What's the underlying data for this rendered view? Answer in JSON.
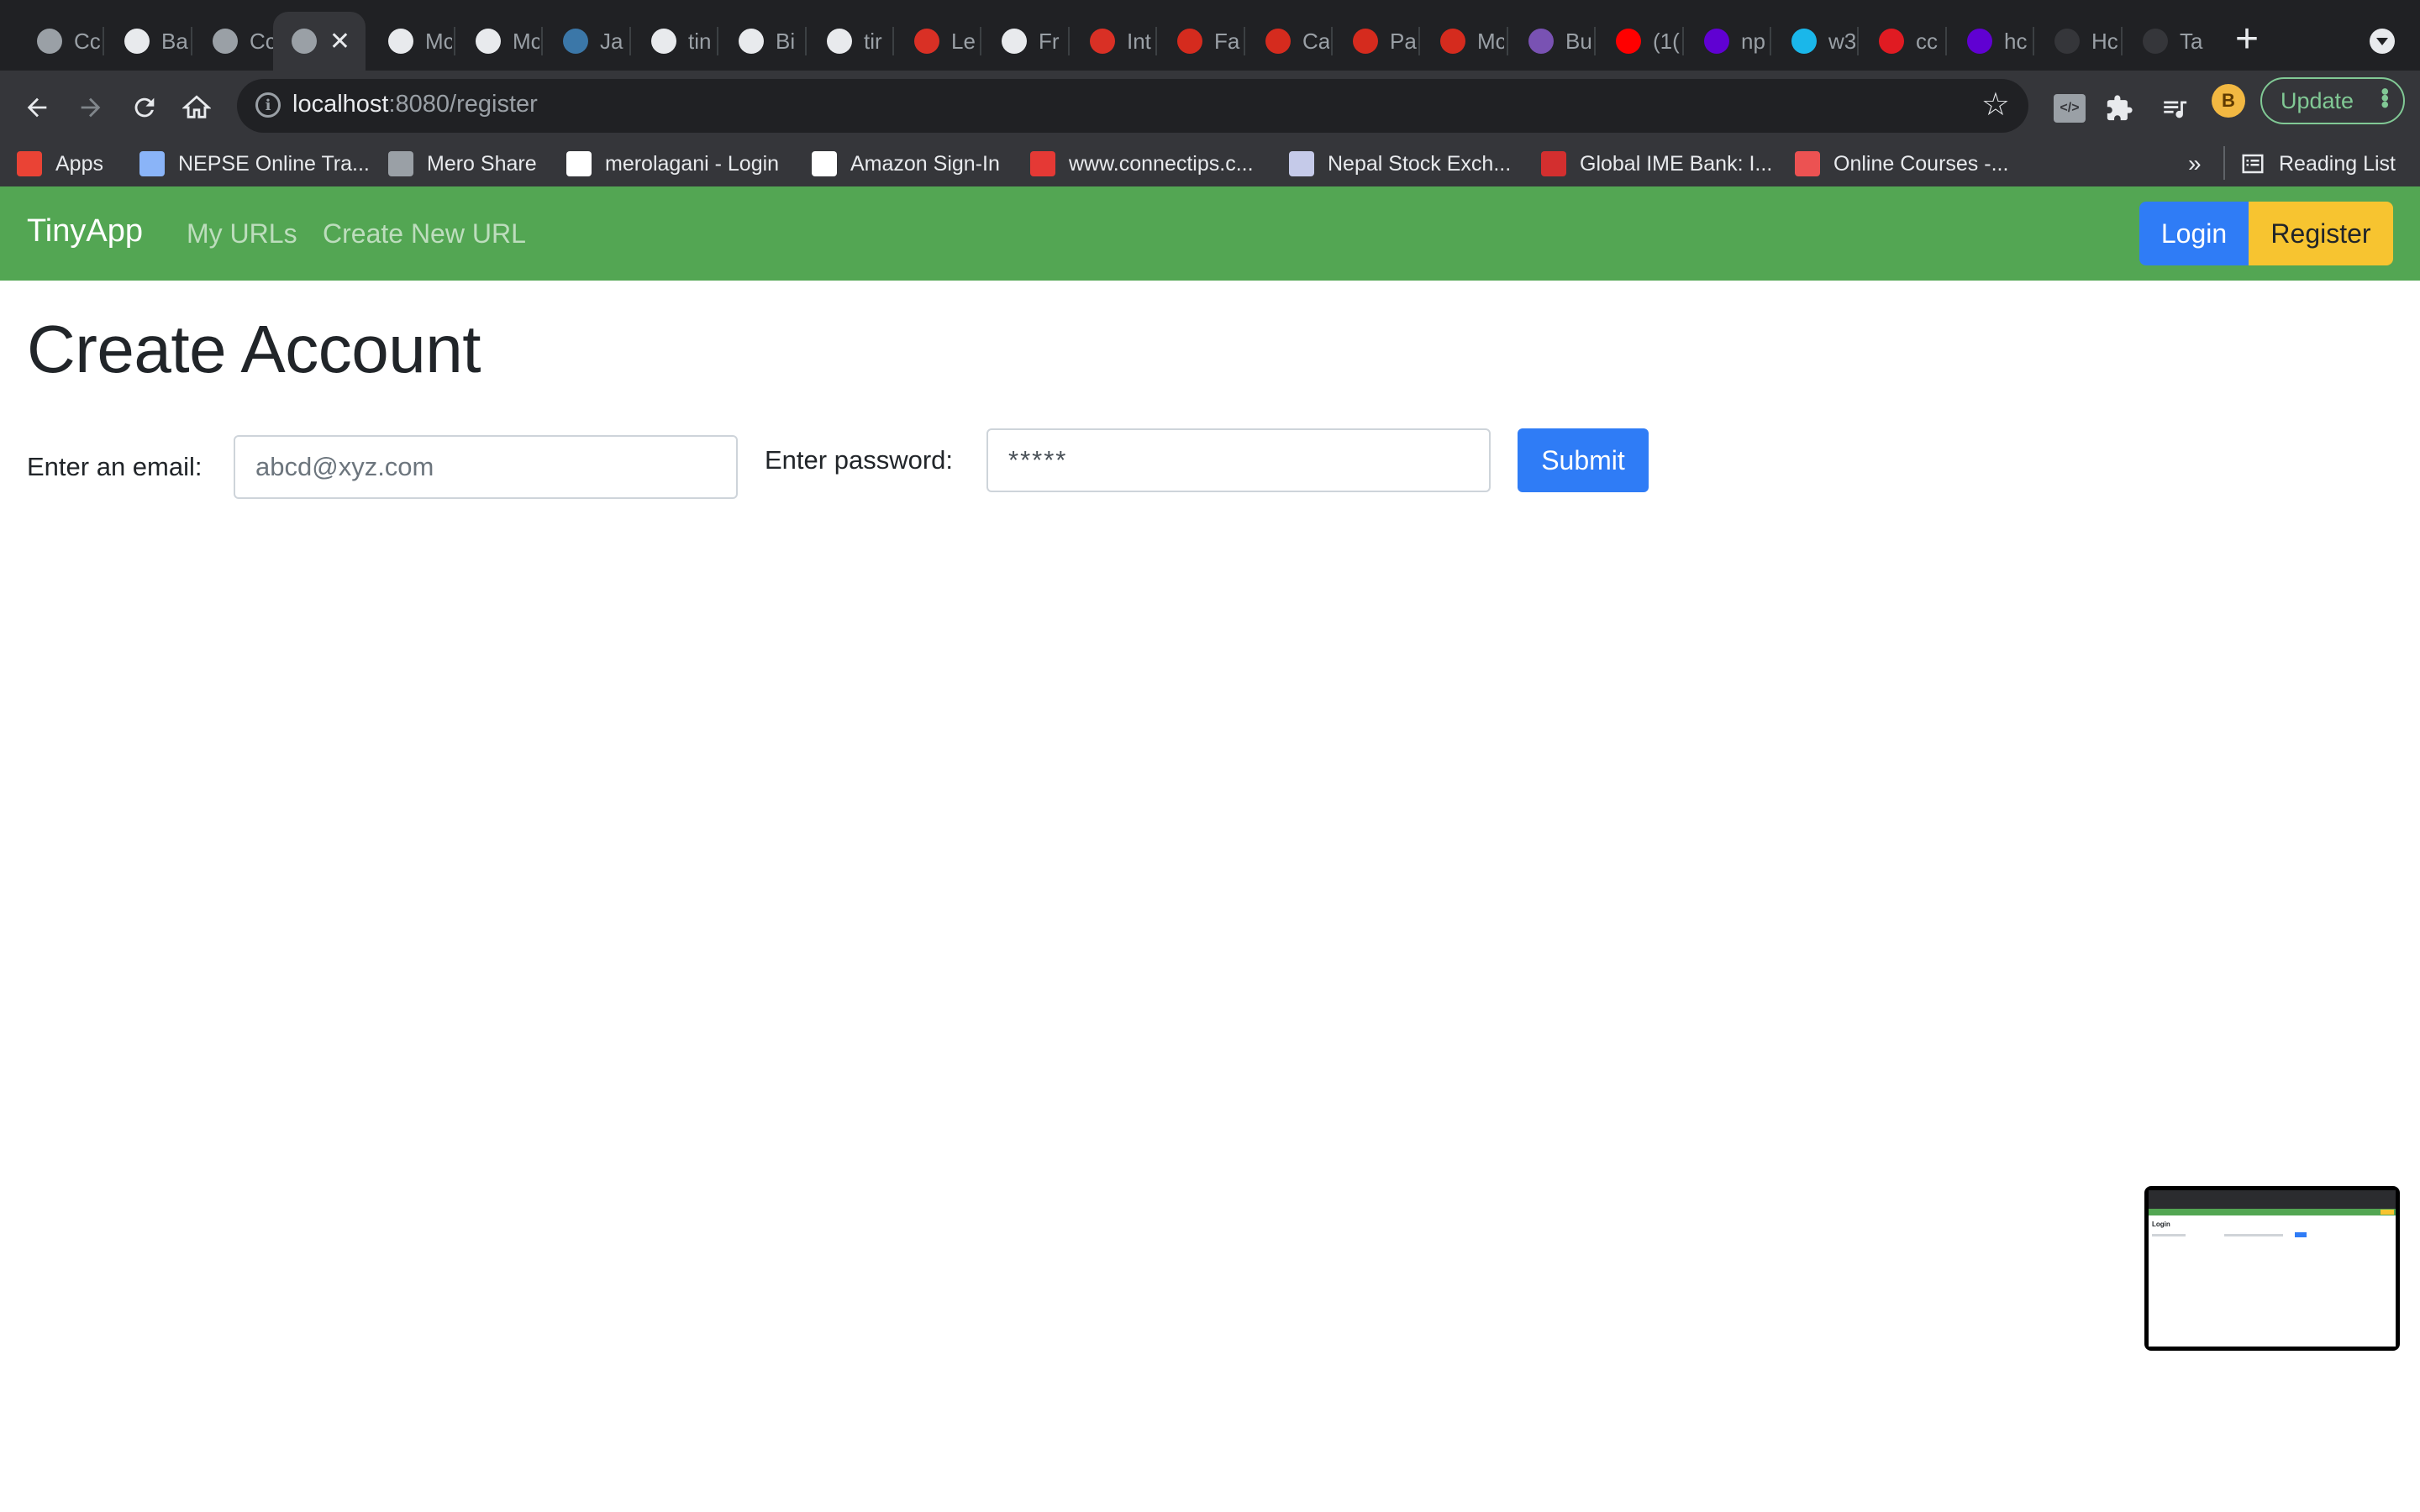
{
  "browser": {
    "tabs": [
      {
        "title": "Cc",
        "icon": "circle-arrow-icon",
        "color": "#202124",
        "bg": "#9aa0a6"
      },
      {
        "title": "Ba",
        "icon": "github-icon",
        "color": "#202124",
        "bg": "#e8eaed"
      },
      {
        "title": "Cc",
        "icon": "circle-arrow-icon",
        "color": "#202124",
        "bg": "#9aa0a6"
      },
      {
        "title": "",
        "icon": "globe-icon",
        "color": "#202124",
        "bg": "#9aa0a6",
        "active": true
      },
      {
        "title": "Mc",
        "icon": "spiral-icon",
        "color": "#202124",
        "bg": "#e8eaed"
      },
      {
        "title": "Mc",
        "icon": "spiral-icon",
        "color": "#202124",
        "bg": "#e8eaed"
      },
      {
        "title": "Ja",
        "icon": "python-icon",
        "color": "#f4c542",
        "bg": "#3b77a8"
      },
      {
        "title": "tin",
        "icon": "github-icon",
        "color": "#202124",
        "bg": "#e8eaed"
      },
      {
        "title": "Bi",
        "icon": "github-icon",
        "color": "#202124",
        "bg": "#e8eaed"
      },
      {
        "title": "tir",
        "icon": "github-icon",
        "color": "#202124",
        "bg": "#e8eaed"
      },
      {
        "title": "Le",
        "icon": "gmail-icon",
        "color": "#ffffff",
        "bg": "#d93025"
      },
      {
        "title": "Fr",
        "icon": "github-icon",
        "color": "#202124",
        "bg": "#e8eaed"
      },
      {
        "title": "Int",
        "icon": "gmail-icon",
        "color": "#ffffff",
        "bg": "#d93025"
      },
      {
        "title": "Fa",
        "icon": "maple-leaf-icon",
        "color": "#ffffff",
        "bg": "#d52b1e"
      },
      {
        "title": "Ca",
        "icon": "maple-leaf-icon",
        "color": "#ffffff",
        "bg": "#d52b1e"
      },
      {
        "title": "Pa",
        "icon": "maple-leaf-icon",
        "color": "#ffffff",
        "bg": "#d52b1e"
      },
      {
        "title": "Mc",
        "icon": "maple-leaf-icon",
        "color": "#ffffff",
        "bg": "#d52b1e"
      },
      {
        "title": "Bu",
        "icon": "bootstrap-icon",
        "color": "#ffffff",
        "bg": "#7952b3"
      },
      {
        "title": "(1(",
        "icon": "youtube-icon",
        "color": "#ffffff",
        "bg": "#ff0000"
      },
      {
        "title": "np",
        "icon": "yahoo-icon",
        "color": "#ffffff",
        "bg": "#6001d2"
      },
      {
        "title": "w3",
        "icon": "vimeo-icon",
        "color": "#ffffff",
        "bg": "#1ab7ea"
      },
      {
        "title": "cc",
        "icon": "red-square-icon",
        "color": "#ffffff",
        "bg": "#e01b22"
      },
      {
        "title": "hc",
        "icon": "yahoo-icon",
        "color": "#ffffff",
        "bg": "#6001d2"
      },
      {
        "title": "Hc",
        "icon": "stackoverflow-icon",
        "color": "#f48024",
        "bg": "#35363a"
      },
      {
        "title": "Ta",
        "icon": "apple-icon",
        "color": "#e8eaed",
        "bg": "#35363a"
      }
    ],
    "new_tab_label": "+",
    "url_host": "localhost",
    "url_path": ":8080/register",
    "update_label": "Update",
    "profile_initial": "B",
    "bookmarks": [
      {
        "label": "Apps",
        "icon": "apps-grid-icon",
        "color": "#ea4335"
      },
      {
        "label": "NEPSE Online Tra...",
        "icon": "nepse-icon",
        "color": "#8ab4f8"
      },
      {
        "label": "Mero Share",
        "icon": "mero-share-icon",
        "color": "#9aa0a6"
      },
      {
        "label": "merolagani - Login",
        "icon": "page-icon",
        "color": "#ffffff"
      },
      {
        "label": "Amazon Sign-In",
        "icon": "amazon-icon",
        "color": "#ffffff"
      },
      {
        "label": "www.connectips.c...",
        "icon": "connectips-icon",
        "color": "#e53935"
      },
      {
        "label": "Nepal Stock Exch...",
        "icon": "nepse-page-icon",
        "color": "#c5cae9"
      },
      {
        "label": "Global IME Bank: I...",
        "icon": "global-ime-icon",
        "color": "#d32f2f"
      },
      {
        "label": "Online Courses -...",
        "icon": "udemy-icon",
        "color": "#ec5252"
      }
    ],
    "more_bookmarks": "»",
    "reading_list": "Reading List"
  },
  "app": {
    "brand": "TinyApp",
    "nav": {
      "my_urls": "My URLs",
      "create_new_url": "Create New URL"
    },
    "login": "Login",
    "register": "Register",
    "heading": "Create Account",
    "form": {
      "email_label": "Enter an email:",
      "email_placeholder": "abcd@xyz.com",
      "password_label": "Enter password:",
      "password_placeholder": "*****",
      "submit": "Submit"
    }
  },
  "preview": {
    "title": "Login"
  },
  "colors": {
    "navbar": "#53a653",
    "primary": "#2f7cf6",
    "warning": "#f7c430"
  }
}
